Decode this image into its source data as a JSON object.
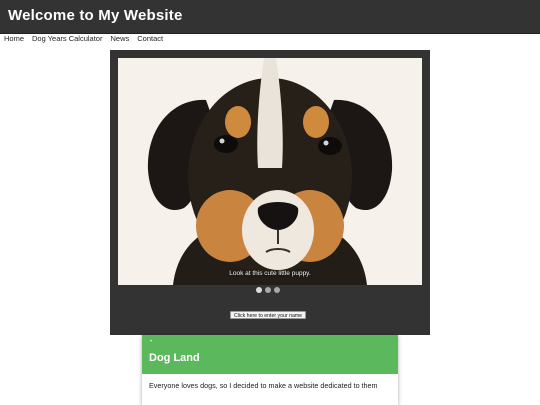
{
  "header": {
    "title": "Welcome to My Website"
  },
  "nav": {
    "items": [
      "Home",
      "Dog Years Calculator",
      "News",
      "Contact"
    ]
  },
  "slider": {
    "caption": "Look at this cute little puppy.",
    "slide_count": 3,
    "active_index": 0,
    "button_label": "Click here to enter your name"
  },
  "card": {
    "bullet": "•",
    "title": "Dog Land",
    "text": "Everyone loves dogs, so I decided to make a website dedicated to them"
  },
  "colors": {
    "header_bg": "#333333",
    "slider_bg": "#333333",
    "card_accent": "#5cb85c"
  }
}
